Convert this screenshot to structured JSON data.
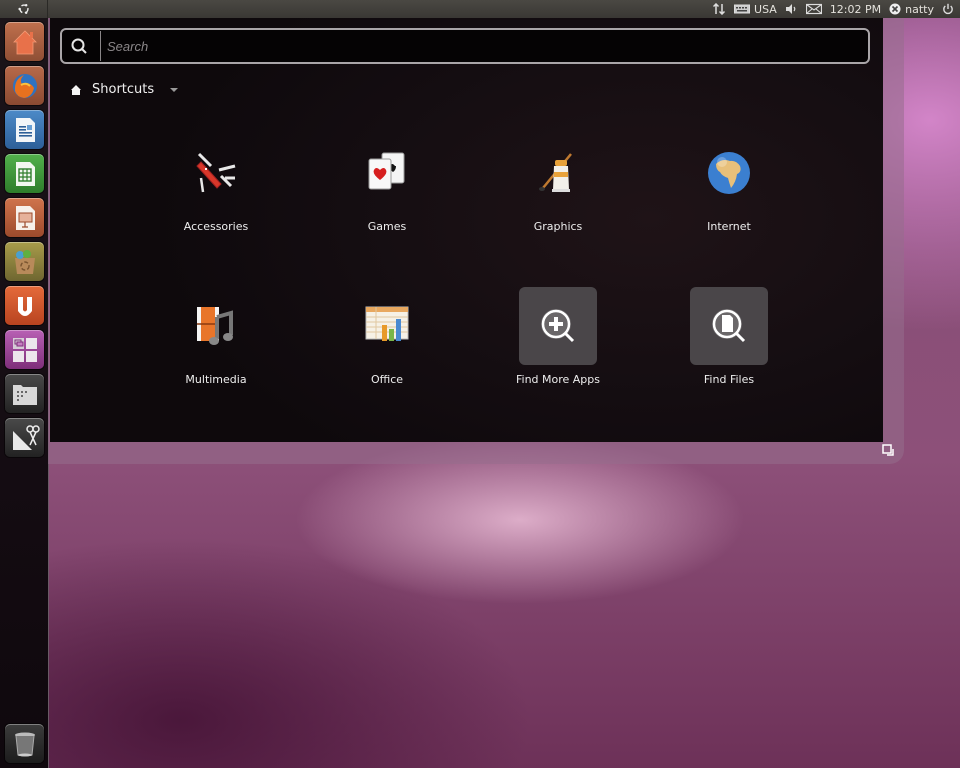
{
  "top_panel": {
    "launcher_button_icon": "ubuntu-logo-icon",
    "indicators": [
      {
        "name": "network",
        "icon": "network-updown-icon",
        "label": ""
      },
      {
        "name": "keyboard",
        "icon": "keyboard-icon",
        "label": "USA"
      },
      {
        "name": "sound",
        "icon": "speaker-icon",
        "label": ""
      },
      {
        "name": "messaging",
        "icon": "envelope-icon",
        "label": ""
      },
      {
        "name": "clock",
        "icon": "",
        "label": "12:02 PM"
      },
      {
        "name": "user",
        "icon": "user-status-icon",
        "label": "natty"
      },
      {
        "name": "session",
        "icon": "power-icon",
        "label": ""
      }
    ]
  },
  "launcher": {
    "items": [
      {
        "name": "Home Folder",
        "icon": "home-folder-icon",
        "color": "#d9643a"
      },
      {
        "name": "Firefox Web Browser",
        "icon": "firefox-icon",
        "color": "#b85a35"
      },
      {
        "name": "LibreOffice Writer",
        "icon": "writer-icon",
        "color": "#3f78b5"
      },
      {
        "name": "LibreOffice Calc",
        "icon": "calc-icon",
        "color": "#3e9a3b"
      },
      {
        "name": "LibreOffice Impress",
        "icon": "impress-icon",
        "color": "#c3623a"
      },
      {
        "name": "Ubuntu Software Center",
        "icon": "software-center-icon",
        "color": "#8f8a3a"
      },
      {
        "name": "Ubuntu One",
        "icon": "ubuntu-one-icon",
        "color": "#dd5a2a"
      },
      {
        "name": "Workspace Switcher",
        "icon": "workspace-switcher-icon",
        "color": "#a44aa0"
      },
      {
        "name": "Applications",
        "icon": "applications-folder-icon",
        "color": "#333333"
      },
      {
        "name": "Files & Folders",
        "icon": "files-folders-icon",
        "color": "#3a3a3a"
      }
    ],
    "trash": {
      "name": "Trash",
      "icon": "trash-icon"
    }
  },
  "dash": {
    "search": {
      "placeholder": "Search",
      "value": ""
    },
    "lens": {
      "label": "Shortcuts",
      "icon": "home-icon"
    },
    "shortcuts": [
      {
        "label": "Accessories",
        "icon": "accessories-icon"
      },
      {
        "label": "Games",
        "icon": "games-cards-icon"
      },
      {
        "label": "Graphics",
        "icon": "graphics-paint-icon"
      },
      {
        "label": "Internet",
        "icon": "globe-icon"
      },
      {
        "label": "Multimedia",
        "icon": "multimedia-icon"
      },
      {
        "label": "Office",
        "icon": "office-chart-icon"
      },
      {
        "label": "Find More Apps",
        "icon": "find-more-apps-icon"
      },
      {
        "label": "Find Files",
        "icon": "find-files-icon"
      }
    ]
  }
}
